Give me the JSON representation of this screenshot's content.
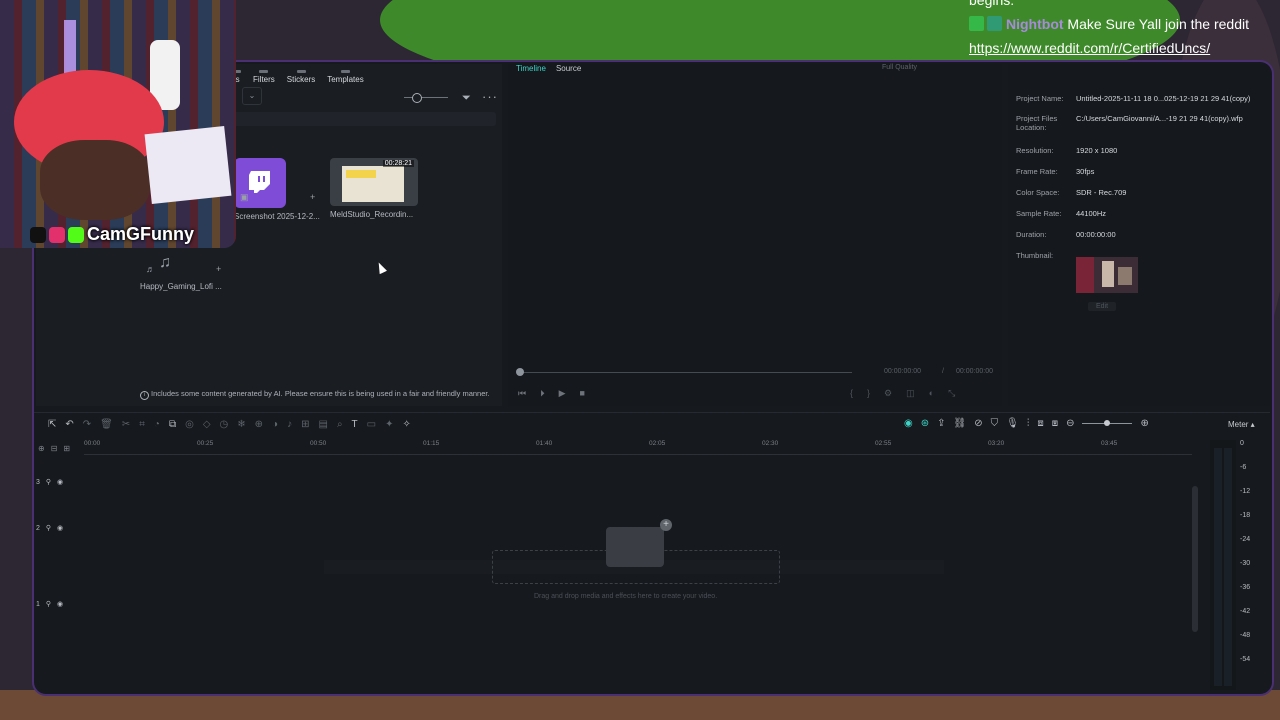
{
  "media": {
    "tabs": [
      "ts",
      "Filters",
      "Stickers",
      "Templates"
    ],
    "clips": [
      {
        "label": "Screenshot 2025-12-2..."
      },
      {
        "label": "MeldStudio_Recordin...",
        "duration": "00:28:21"
      },
      {
        "label": "Happy_Gaming_Lofi ..."
      }
    ],
    "ai_note": "Includes some content generated by AI. Please ensure this is being used in a fair and friendly manner."
  },
  "player": {
    "tabs": [
      "Timeline",
      "Source"
    ],
    "quality": "Full Quality",
    "time_current": "00:00:00:00",
    "time_sep": "/",
    "time_total": "00:00:00:00"
  },
  "info": {
    "rows": [
      {
        "k": "Project Name:",
        "v": "Untitled-2025-11-11 18 0...025-12-19 21 29 41(copy)"
      },
      {
        "k": "Project Files Location:",
        "v": "C:/Users/CamGiovanni/A...-19 21 29 41(copy).wfp"
      },
      {
        "k": "Resolution:",
        "v": "1920 x 1080"
      },
      {
        "k": "Frame Rate:",
        "v": "30fps"
      },
      {
        "k": "Color Space:",
        "v": "SDR - Rec.709"
      },
      {
        "k": "Sample Rate:",
        "v": "44100Hz"
      },
      {
        "k": "Duration:",
        "v": "00:00:00:00"
      },
      {
        "k": "Thumbnail:",
        "v": ""
      }
    ],
    "edit_label": "Edit"
  },
  "timeline": {
    "meter_label": "Meter",
    "ruler": [
      "00:00",
      "00:25",
      "00:50",
      "01:15",
      "01:40",
      "02:05",
      "02:30",
      "02:55",
      "03:20",
      "03:45"
    ],
    "drop_text": "Drag and drop media and effects here to create your video.",
    "meter_scale": [
      "0",
      "-6",
      "-12",
      "-18",
      "-24",
      "-30",
      "-36",
      "-42",
      "-48",
      "-54"
    ],
    "tracks": [
      "3",
      "2",
      "1"
    ]
  },
  "chat": {
    "prev": "begins.",
    "nick": "Nightbot",
    "message": "Make Sure Yall join the reddit",
    "link": "https://www.reddit.com/r/CertifiedUncs/"
  },
  "cam": {
    "name": "CamGFunny"
  },
  "colors": {
    "accent": "#3fd4c7",
    "frame": "#4a2f73",
    "twitch": "#7f4cd8",
    "nick": "#a78bda"
  }
}
